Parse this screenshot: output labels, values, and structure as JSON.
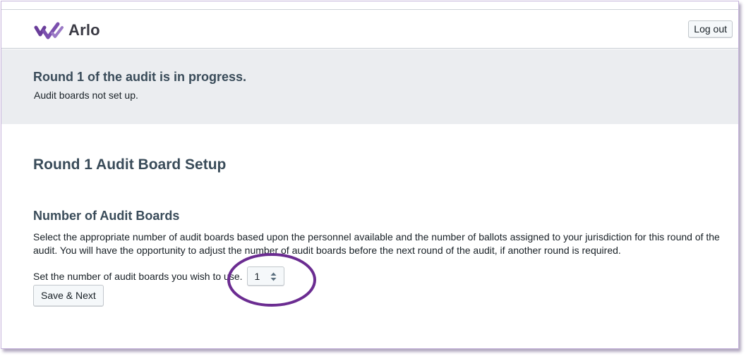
{
  "header": {
    "logo_text": "Arlo",
    "logout_label": "Log out"
  },
  "status": {
    "title": "Round 1 of the audit is in progress.",
    "subtitle": "Audit boards not set up."
  },
  "setup": {
    "title": "Round 1 Audit Board Setup",
    "section_title": "Number of Audit Boards",
    "description": "Select the appropriate number of audit boards based upon the personnel available and the number of ballots assigned to your jurisdiction for this round of the audit. You will have the opportunity to adjust the number of audit boards before the next round of the audit, if another round is required.",
    "count_label": "Set the number of audit boards you wish to use.",
    "count_value": "1",
    "save_label": "Save & Next"
  },
  "colors": {
    "brand": "#6a3d9a",
    "annotation": "#6b2c91",
    "banner_bg": "#ebedf0",
    "heading": "#394b59"
  },
  "icons": {
    "logo": "arlo-checkmark-logo-icon",
    "select": "caret-up-down-icon"
  }
}
